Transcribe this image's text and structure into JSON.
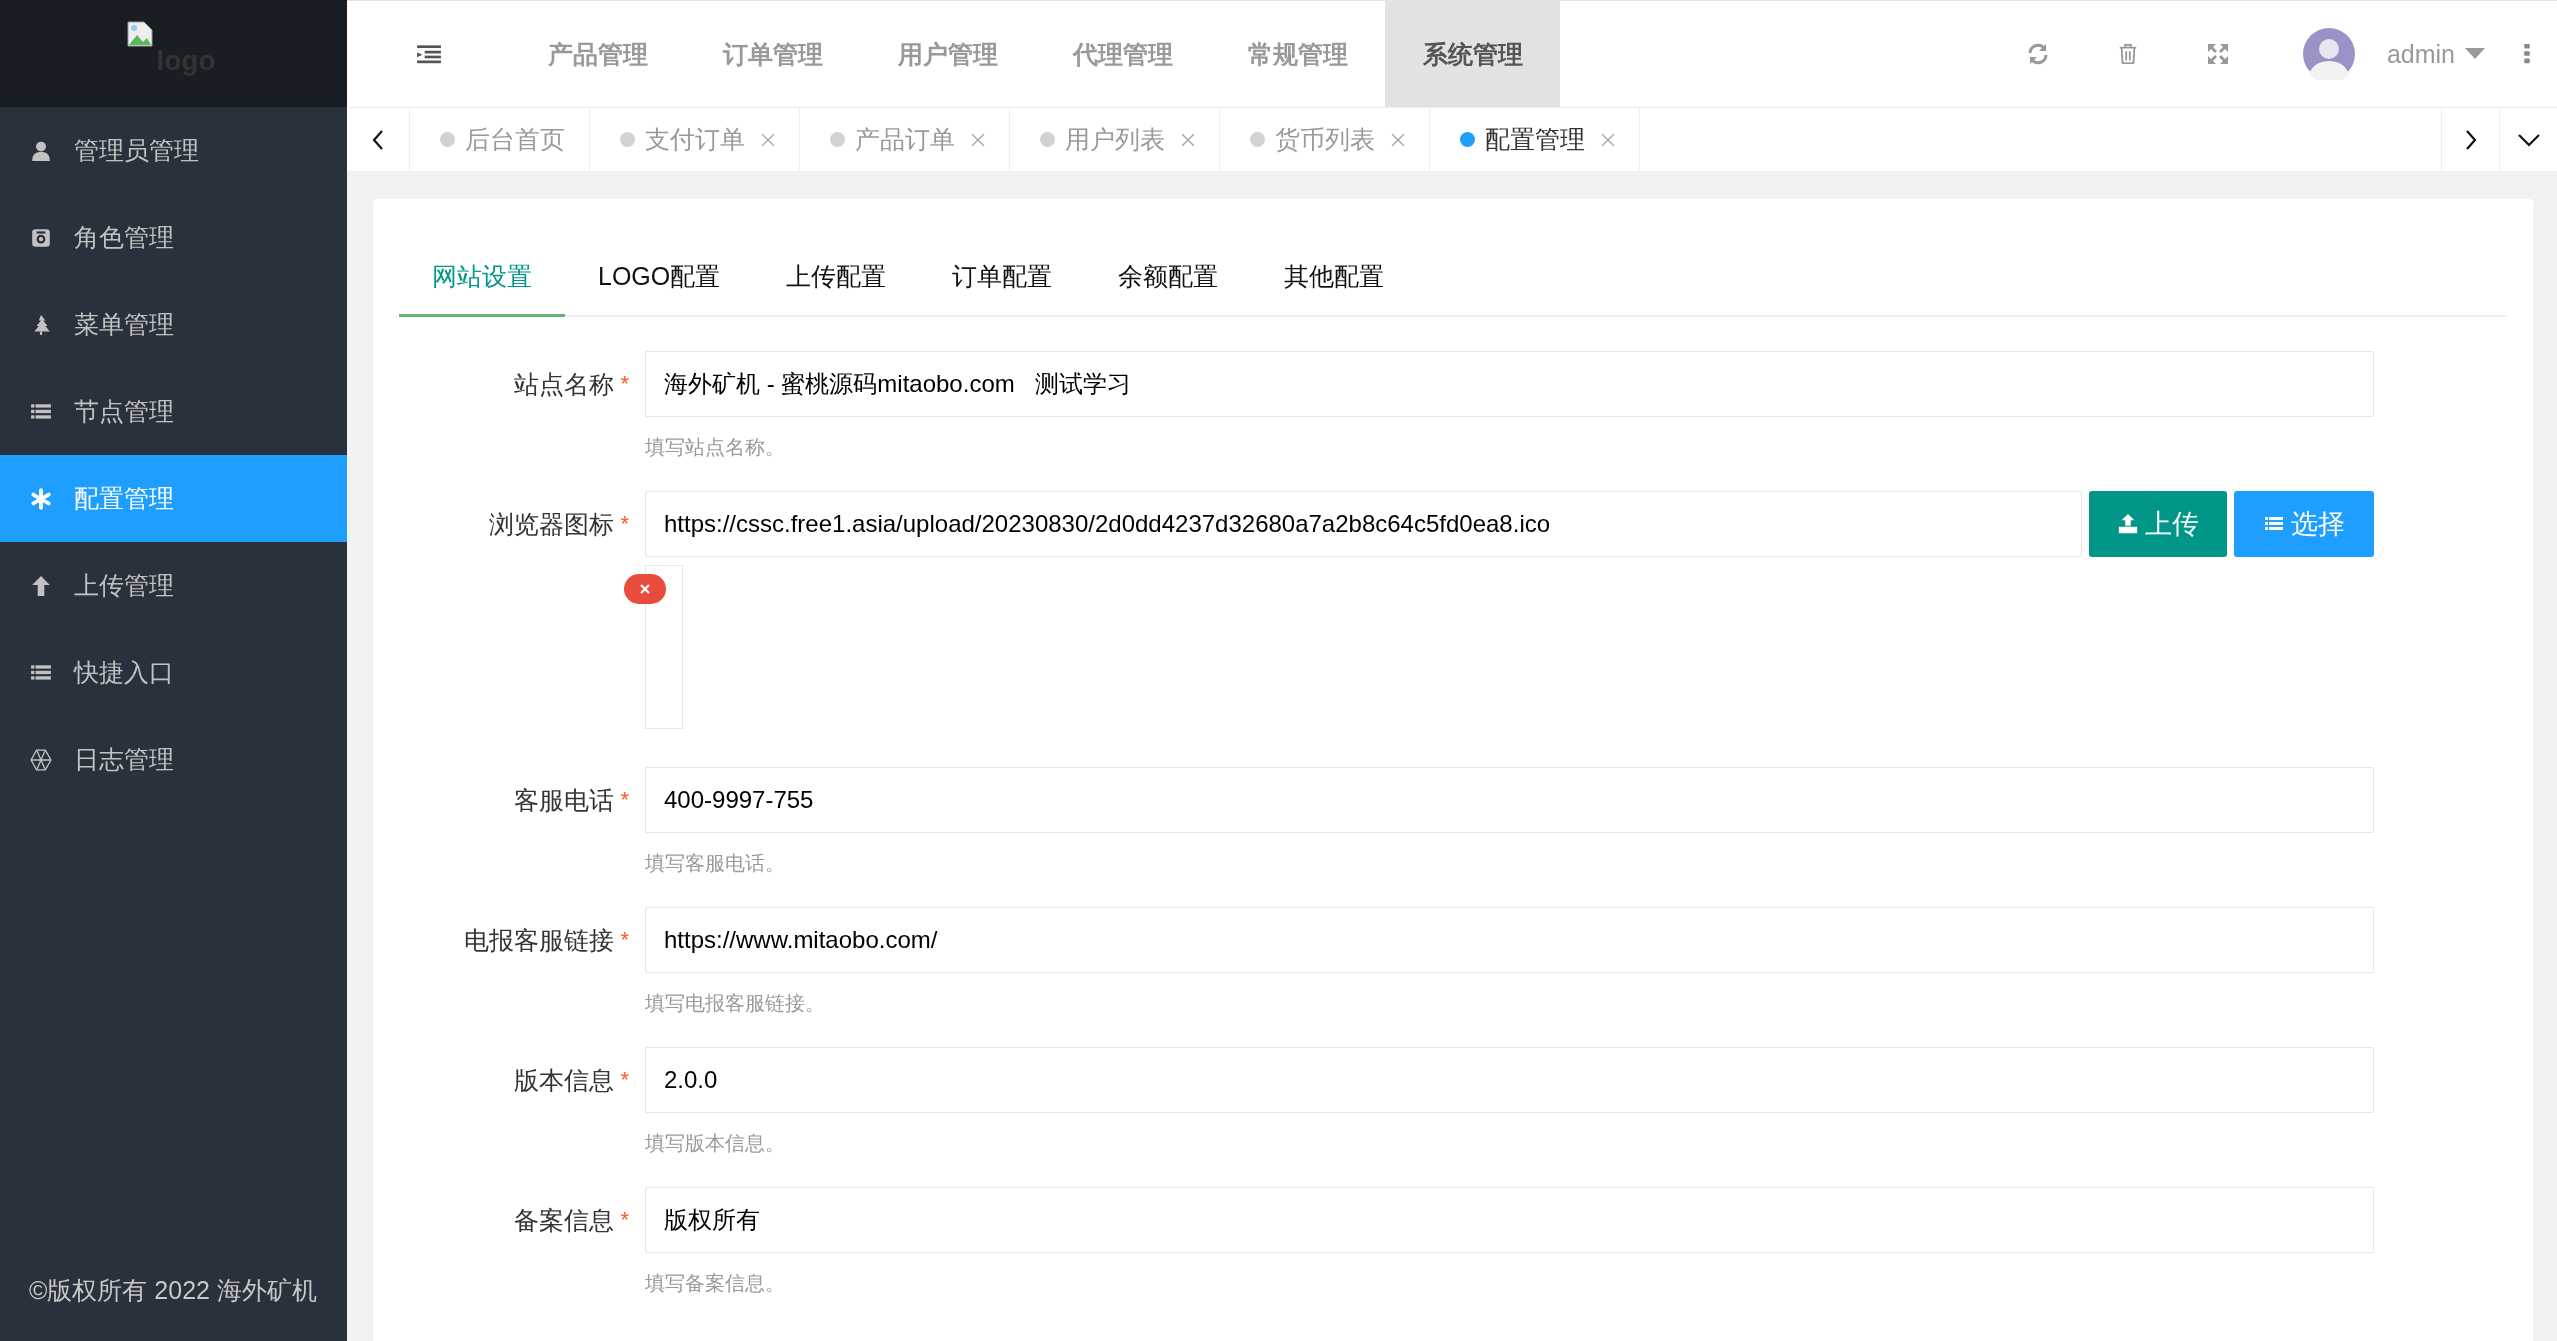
{
  "sidebar": {
    "logo_alt": "logo",
    "items": [
      {
        "label": "管理员管理",
        "kind": "user",
        "selected": false
      },
      {
        "label": "角色管理",
        "kind": "badge",
        "selected": false
      },
      {
        "label": "菜单管理",
        "kind": "tree",
        "selected": false
      },
      {
        "label": "节点管理",
        "kind": "list",
        "selected": false
      },
      {
        "label": "配置管理",
        "kind": "asterisk",
        "selected": true
      },
      {
        "label": "上传管理",
        "kind": "upload",
        "selected": false
      },
      {
        "label": "快捷入口",
        "kind": "list",
        "selected": false
      },
      {
        "label": "日志管理",
        "kind": "log",
        "selected": false
      }
    ],
    "footer": "©版权所有 2022 海外矿机"
  },
  "top_nav": {
    "items": [
      {
        "label": "产品管理",
        "selected": false
      },
      {
        "label": "订单管理",
        "selected": false
      },
      {
        "label": "用户管理",
        "selected": false
      },
      {
        "label": "代理管理",
        "selected": false
      },
      {
        "label": "常规管理",
        "selected": false
      },
      {
        "label": "系统管理",
        "selected": true
      }
    ],
    "user": "admin"
  },
  "page_tabs": [
    {
      "label": "后台首页",
      "selected": false,
      "closable": false
    },
    {
      "label": "支付订单",
      "selected": false,
      "closable": true
    },
    {
      "label": "产品订单",
      "selected": false,
      "closable": true
    },
    {
      "label": "用户列表",
      "selected": false,
      "closable": true
    },
    {
      "label": "货币列表",
      "selected": false,
      "closable": true
    },
    {
      "label": "配置管理",
      "selected": true,
      "closable": true
    }
  ],
  "settings_tabs": [
    {
      "label": "网站设置",
      "selected": true
    },
    {
      "label": "LOGO配置",
      "selected": false
    },
    {
      "label": "上传配置",
      "selected": false
    },
    {
      "label": "订单配置",
      "selected": false
    },
    {
      "label": "余额配置",
      "selected": false
    },
    {
      "label": "其他配置",
      "selected": false
    }
  ],
  "form": {
    "fields": [
      {
        "kind": "text",
        "label": "站点名称",
        "required_mark": "*",
        "value": "海外矿机 - 蜜桃源码mitaobo.com   测试学习",
        "help": "填写站点名称。"
      },
      {
        "kind": "file",
        "label": "浏览器图标",
        "required_mark": "*",
        "value": "https://cssc.free1.asia/upload/20230830/2d0dd4237d32680a7a2b8c64c5fd0ea8.ico",
        "buttons": [
          "上传",
          "选择"
        ]
      },
      {
        "kind": "text",
        "label": "客服电话",
        "required_mark": "*",
        "value": "400-9997-755",
        "help": "填写客服电话。"
      },
      {
        "kind": "text",
        "label": "电报客服链接",
        "required_mark": "*",
        "value": "https://www.mitaobo.com/",
        "help": "填写电报客服链接。"
      },
      {
        "kind": "text",
        "label": "版本信息",
        "required_mark": "*",
        "value": "2.0.0",
        "help": "填写版本信息。"
      },
      {
        "kind": "text",
        "label": "备案信息",
        "required_mark": "*",
        "value": "版权所有",
        "help": "填写备案信息。"
      }
    ]
  }
}
